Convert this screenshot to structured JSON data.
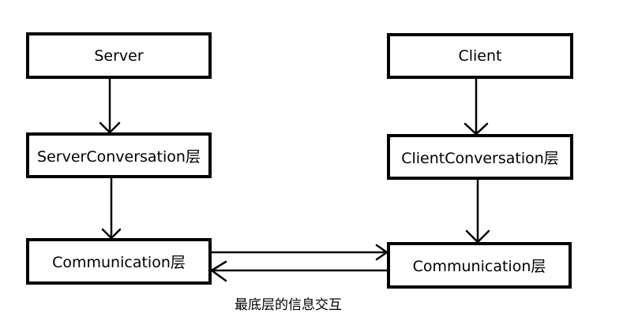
{
  "diagram": {
    "nodes": {
      "server": "Server",
      "client": "Client",
      "server_conversation": "ServerConversation层",
      "client_conversation": "ClientConversation层",
      "server_communication": "Communication层",
      "client_communication": "Communication层"
    },
    "edges": [
      {
        "from": "server",
        "to": "server_conversation"
      },
      {
        "from": "server_conversation",
        "to": "server_communication"
      },
      {
        "from": "client",
        "to": "client_conversation"
      },
      {
        "from": "client_conversation",
        "to": "client_communication"
      },
      {
        "from": "server_communication",
        "to": "client_communication"
      },
      {
        "from": "client_communication",
        "to": "server_communication"
      }
    ],
    "caption": "最底层的信息交互"
  }
}
